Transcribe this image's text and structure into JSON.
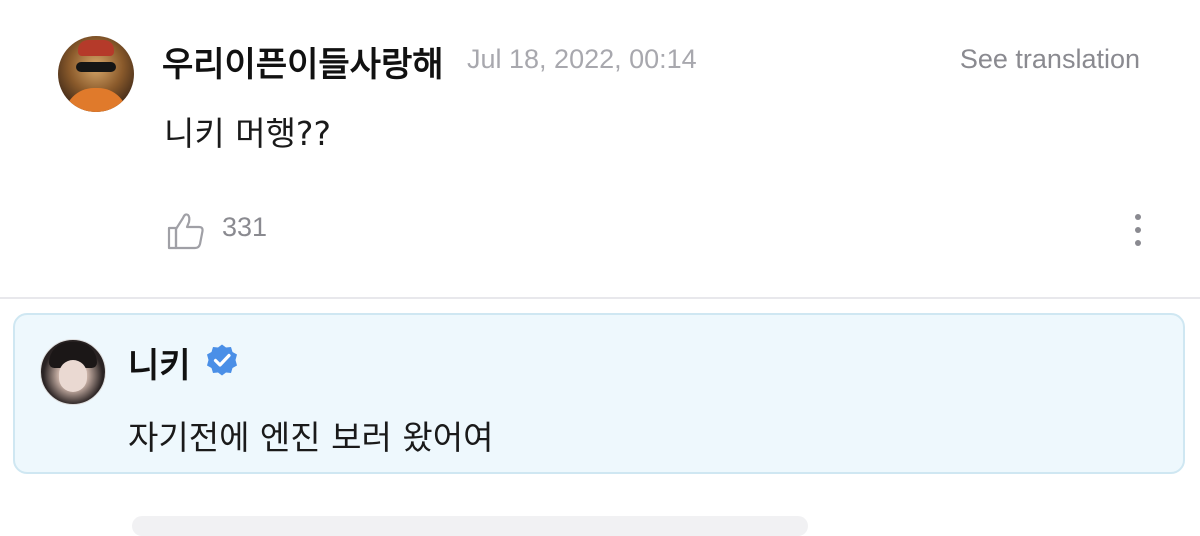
{
  "comment": {
    "username": "우리이픈이들사랑해",
    "timestamp": "Jul 18, 2022, 00:14",
    "translate_label": "See translation",
    "text": "니키 머행??",
    "like_count": "331",
    "like_icon": "thumbs-up-icon",
    "more_icon": "more-vertical-icon"
  },
  "reply": {
    "name": "니키",
    "verified_icon": "verified-badge-icon",
    "text": "자기전에 엔진 보러 왔어여"
  },
  "colors": {
    "reply_background": "#eef8fd",
    "reply_border": "#cfe7f2",
    "verified": "#4a8fe7",
    "muted_text": "#8a8a90"
  }
}
